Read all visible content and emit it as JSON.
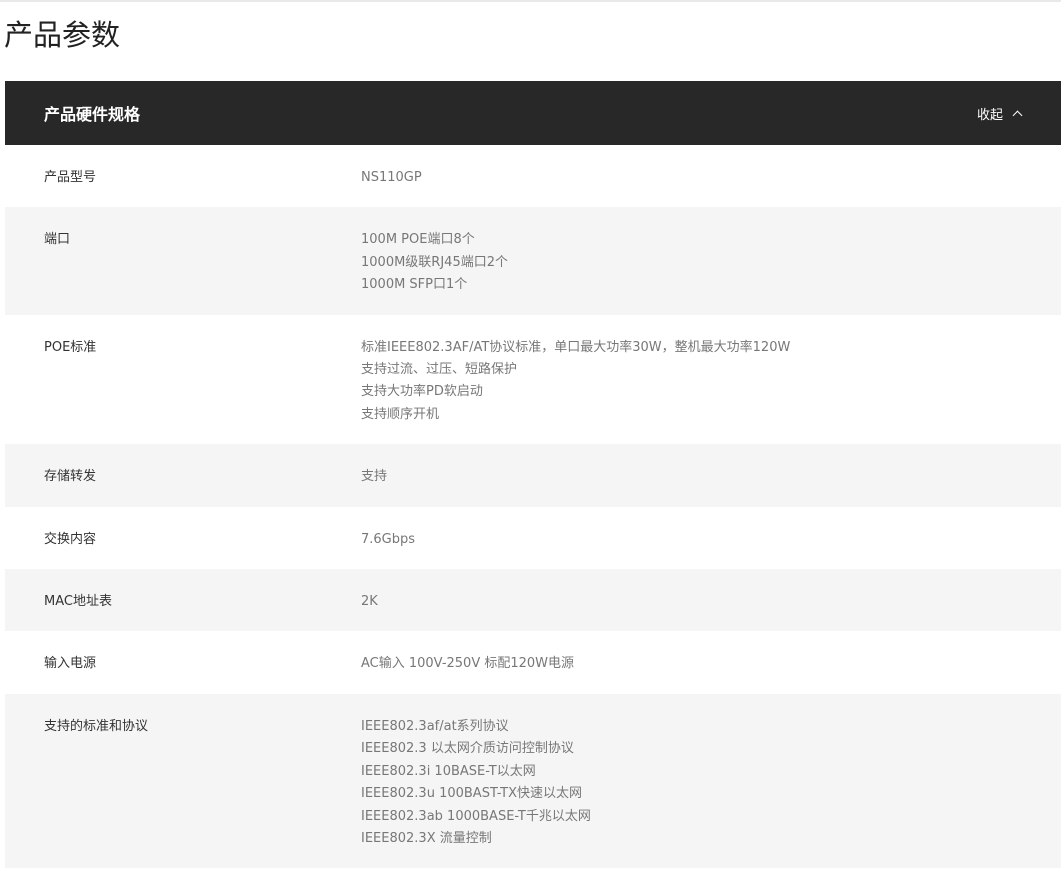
{
  "page": {
    "title": "产品参数"
  },
  "spec_section": {
    "title": "产品硬件规格",
    "toggle_label": "收起",
    "toggle_icon": "chevron-up-icon",
    "row_stripe_color": "#f5f5f5",
    "header_color": "#282828",
    "rows": [
      {
        "label": "产品型号",
        "values": [
          "NS110GP"
        ]
      },
      {
        "label": "端口",
        "values": [
          "100M POE端口8个",
          "1000M级联RJ45端口2个",
          "1000M SFP口1个"
        ]
      },
      {
        "label": "POE标准",
        "values": [
          "标准IEEE802.3AF/AT协议标准，单口最大功率30W，整机最大功率120W",
          "支持过流、过压、短路保护",
          "支持大功率PD软启动",
          "支持顺序开机"
        ]
      },
      {
        "label": "存储转发",
        "values": [
          "支持"
        ]
      },
      {
        "label": "交换内容",
        "values": [
          "7.6Gbps"
        ]
      },
      {
        "label": "MAC地址表",
        "values": [
          "2K"
        ]
      },
      {
        "label": "输入电源",
        "values": [
          "AC输入 100V-250V 标配120W电源"
        ]
      },
      {
        "label": "支持的标准和协议",
        "values": [
          "IEEE802.3af/at系列协议",
          "IEEE802.3 以太网介质访问控制协议",
          "IEEE802.3i 10BASE-T以太网",
          "IEEE802.3u 100BAST-TX快速以太网",
          "IEEE802.3ab 1000BASE-T千兆以太网",
          "IEEE802.3X 流量控制"
        ]
      }
    ]
  }
}
